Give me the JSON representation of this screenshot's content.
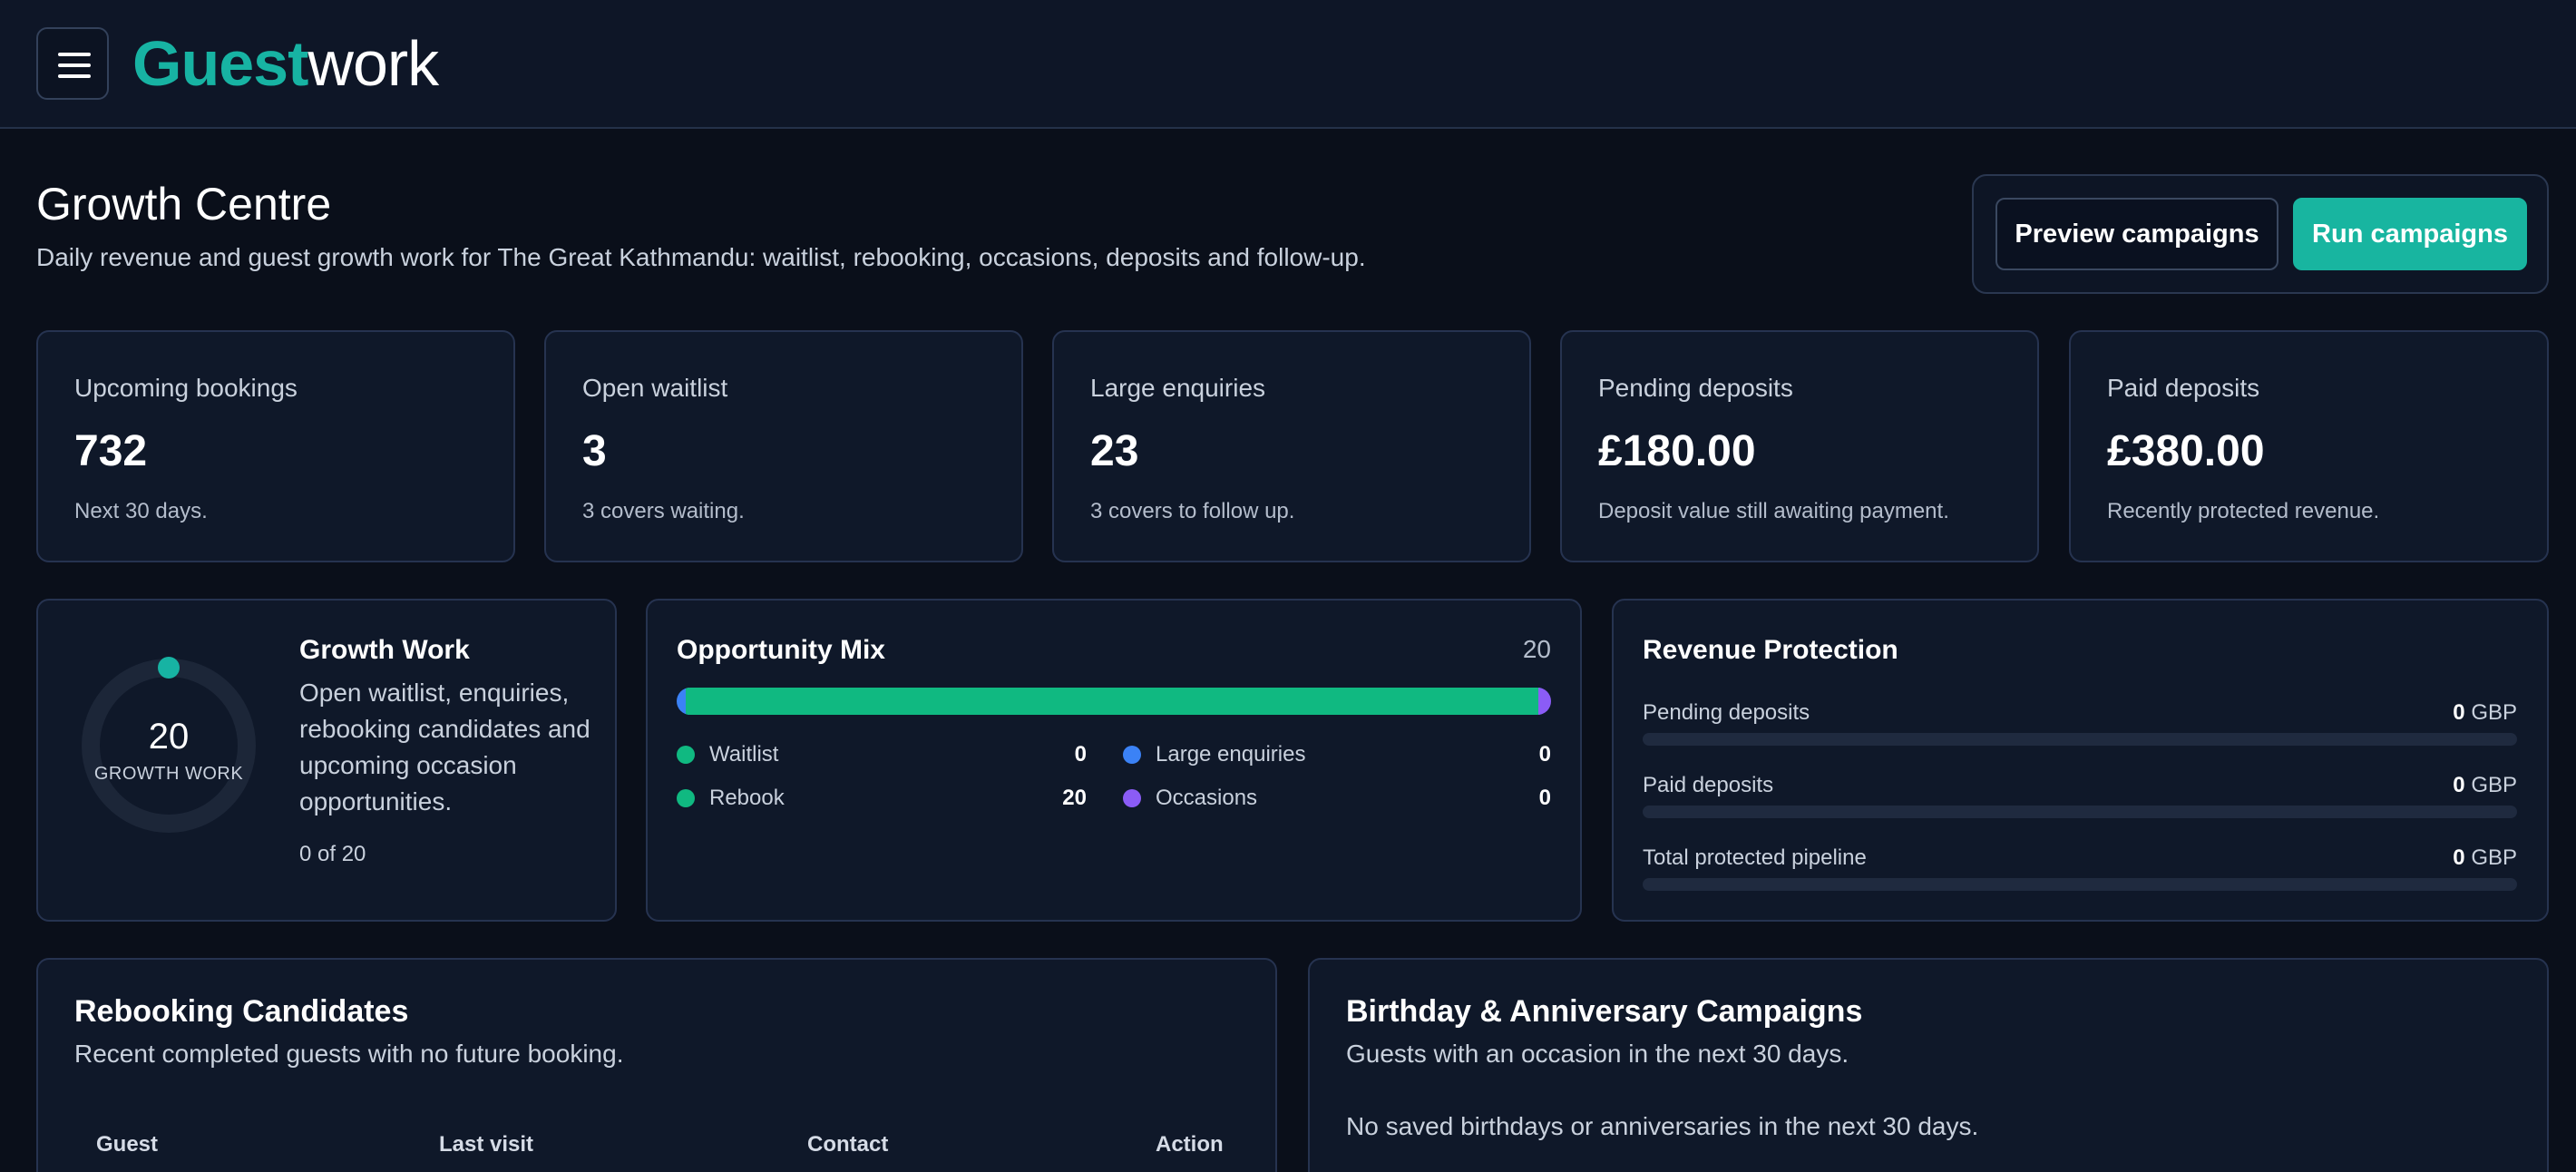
{
  "header": {
    "logo_part1": "Guest",
    "logo_part2": "work"
  },
  "page": {
    "title": "Growth Centre",
    "subtitle": "Daily revenue and guest growth work for The Great Kathmandu: waitlist, rebooking, occasions, deposits and follow-up."
  },
  "actions": {
    "preview_label": "Preview campaigns",
    "run_label": "Run campaigns"
  },
  "stats": [
    {
      "label": "Upcoming bookings",
      "value": "732",
      "note": "Next 30 days."
    },
    {
      "label": "Open waitlist",
      "value": "3",
      "note": "3 covers waiting."
    },
    {
      "label": "Large enquiries",
      "value": "23",
      "note": "3 covers to follow up."
    },
    {
      "label": "Pending deposits",
      "value": "£180.00",
      "note": "Deposit value still awaiting payment."
    },
    {
      "label": "Paid deposits",
      "value": "£380.00",
      "note": "Recently protected revenue."
    }
  ],
  "growth_work": {
    "count": "20",
    "donut_label": "GROWTH WORK",
    "title": "Growth Work",
    "description": "Open waitlist, enquiries, rebooking candidates and upcoming occasion opportunities.",
    "progress_text": "0 of 20",
    "completed_fraction": 0
  },
  "opportunity_mix": {
    "title": "Opportunity Mix",
    "total": "20",
    "items": [
      {
        "label": "Waitlist",
        "value": "0",
        "color": "#10b981"
      },
      {
        "label": "Large enquiries",
        "value": "0",
        "color": "#3b82f6"
      },
      {
        "label": "Rebook",
        "value": "20",
        "color": "#10b981"
      },
      {
        "label": "Occasions",
        "value": "0",
        "color": "#8b5cf6"
      }
    ]
  },
  "revenue_protection": {
    "title": "Revenue Protection",
    "rows": [
      {
        "label": "Pending deposits",
        "amount": "0",
        "unit": "GBP"
      },
      {
        "label": "Paid deposits",
        "amount": "0",
        "unit": "GBP"
      },
      {
        "label": "Total protected pipeline",
        "amount": "0",
        "unit": "GBP"
      }
    ]
  },
  "rebooking": {
    "title": "Rebooking Candidates",
    "subtitle": "Recent completed guests with no future booking.",
    "columns": [
      "Guest",
      "Last visit",
      "Contact",
      "Action"
    ]
  },
  "occasions": {
    "title": "Birthday & Anniversary Campaigns",
    "subtitle": "Guests with an occasion in the next 30 days.",
    "empty": "No saved birthdays or anniversaries in the next 30 days."
  }
}
